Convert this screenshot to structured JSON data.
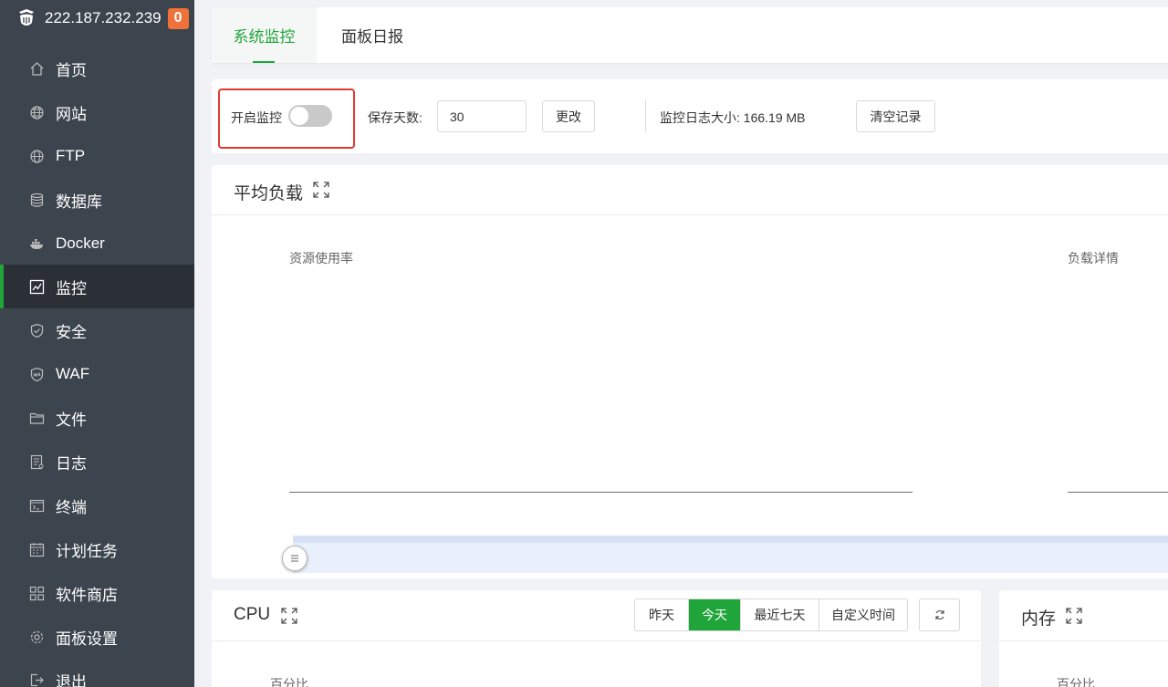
{
  "sidebar": {
    "server_ip": "222.187.232.239",
    "badge_count": "0",
    "items": [
      {
        "label": "首页",
        "icon": "home-icon"
      },
      {
        "label": "网站",
        "icon": "globe-icon"
      },
      {
        "label": "FTP",
        "icon": "ftp-globe-icon"
      },
      {
        "label": "数据库",
        "icon": "database-icon"
      },
      {
        "label": "Docker",
        "icon": "docker-icon"
      },
      {
        "label": "监控",
        "icon": "monitor-chart-icon",
        "active": true
      },
      {
        "label": "安全",
        "icon": "shield-icon"
      },
      {
        "label": "WAF",
        "icon": "waf-shield-icon"
      },
      {
        "label": "文件",
        "icon": "folder-icon"
      },
      {
        "label": "日志",
        "icon": "log-file-icon"
      },
      {
        "label": "终端",
        "icon": "terminal-icon"
      },
      {
        "label": "计划任务",
        "icon": "calendar-icon"
      },
      {
        "label": "软件商店",
        "icon": "apps-grid-icon"
      },
      {
        "label": "面板设置",
        "icon": "gear-icon"
      },
      {
        "label": "退出",
        "icon": "logout-icon"
      }
    ]
  },
  "tabs": {
    "system_monitor": "系统监控",
    "panel_daily": "面板日报"
  },
  "controls": {
    "enable_monitor_label": "开启监控",
    "enable_monitor_on": false,
    "save_days_label": "保存天数:",
    "save_days_value": "30",
    "change_button": "更改",
    "log_size_label": "监控日志大小: 166.19 MB",
    "clear_button": "清空记录"
  },
  "load_card": {
    "title": "平均负载",
    "resource_usage_label": "资源使用率",
    "load_detail_label": "负载详情"
  },
  "cpu_card": {
    "title": "CPU",
    "percent_label": "百分比",
    "range_buttons": [
      "昨天",
      "今天",
      "最近七天",
      "自定义时间"
    ],
    "active_range": "今天"
  },
  "mem_card": {
    "title": "内存",
    "percent_label": "百分比"
  },
  "colors": {
    "accent": "#20a53a",
    "sidebar_bg": "#3c444d",
    "highlight_border": "#e23b2e",
    "badge": "#f0713a"
  }
}
